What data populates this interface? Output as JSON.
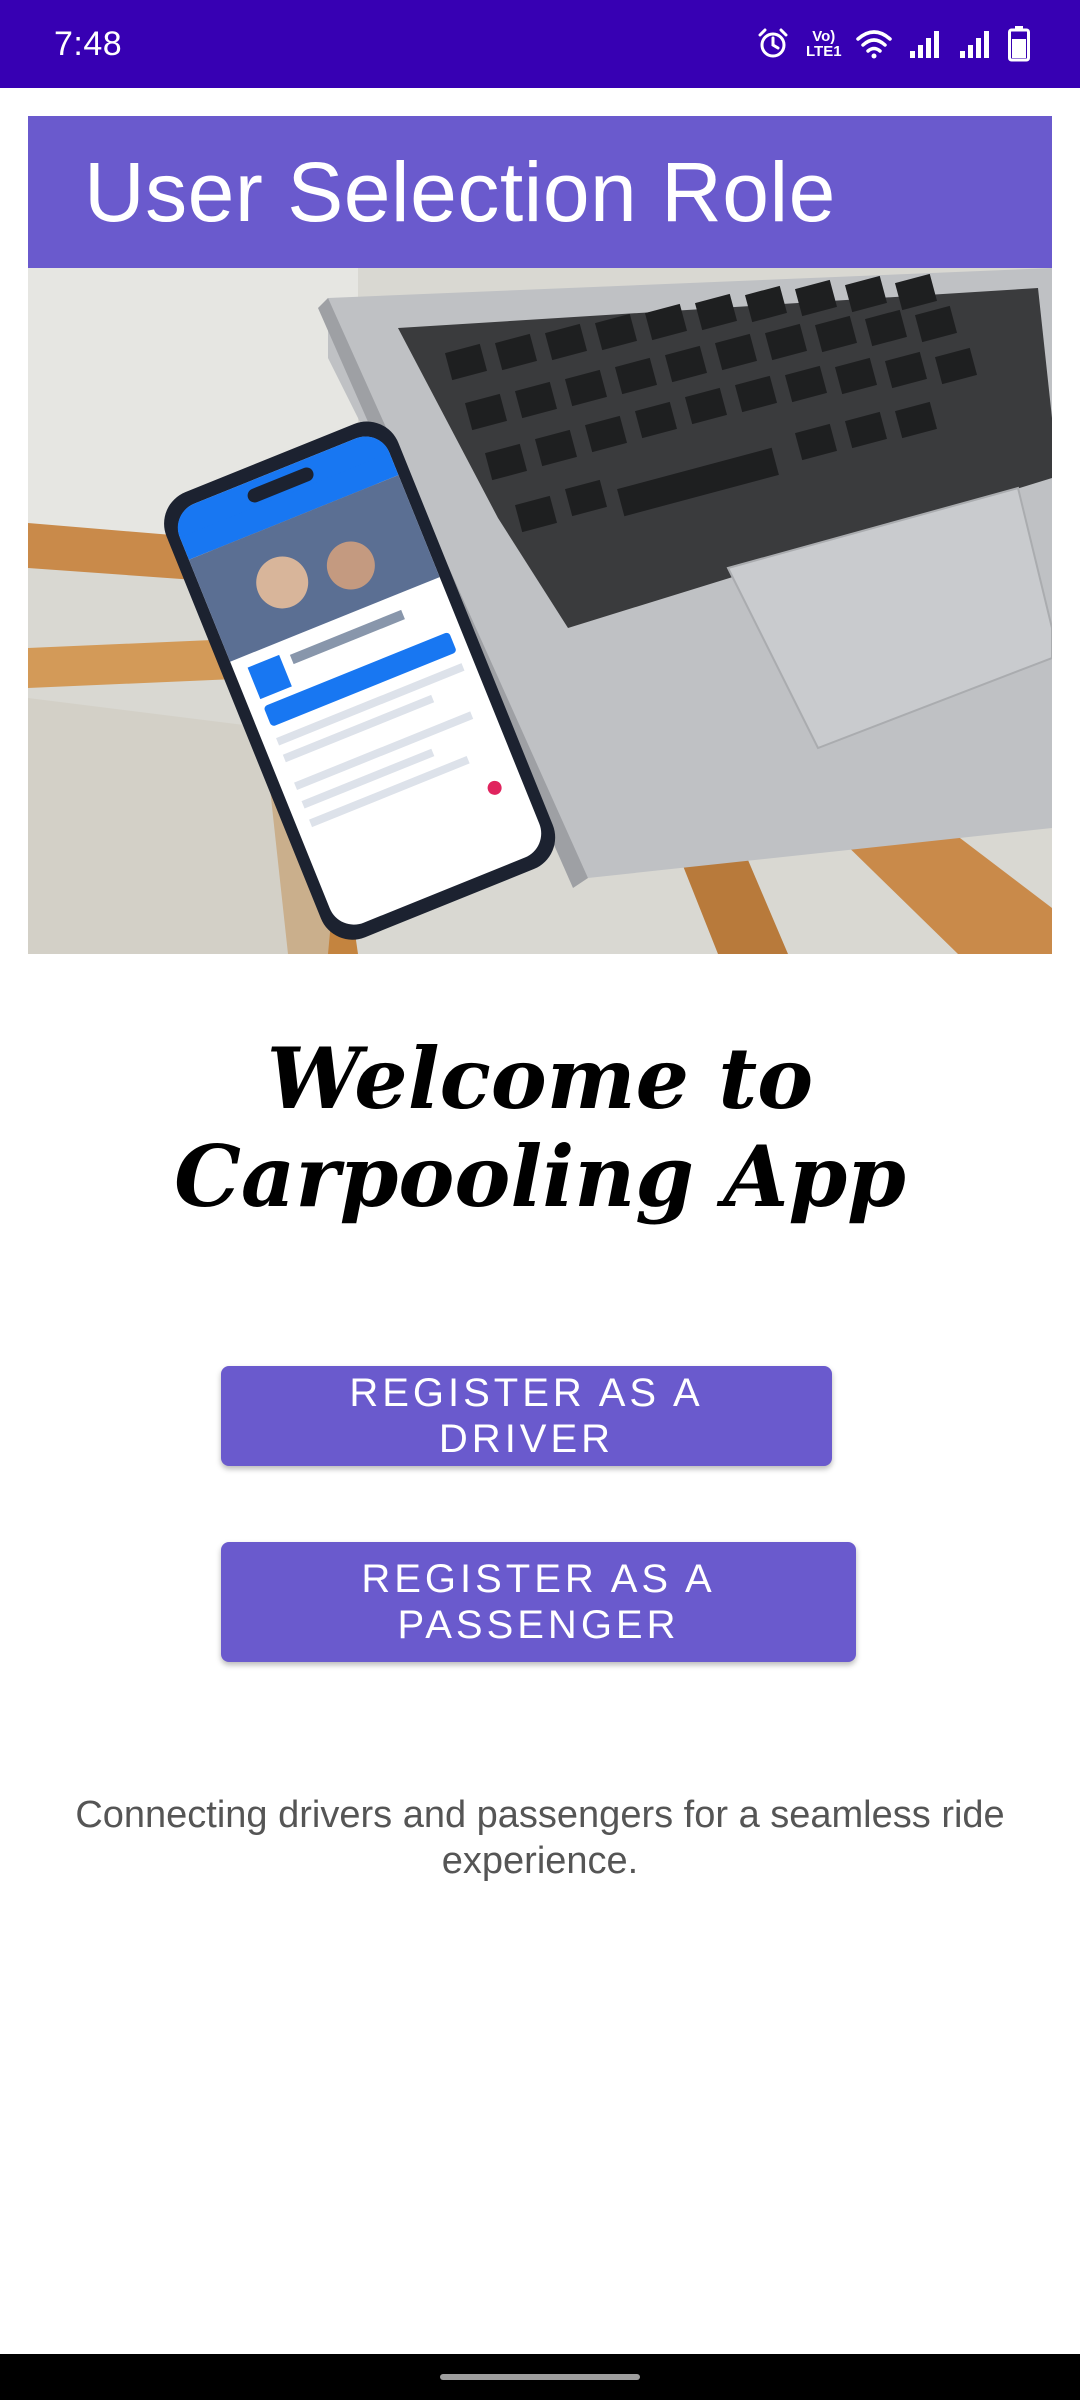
{
  "status_bar": {
    "time": "7:48",
    "volte_line1": "Vo)",
    "volte_line2": "LTE1",
    "icons": [
      "alarm-icon",
      "volte-icon",
      "wifi-icon",
      "signal-icon",
      "signal-icon",
      "battery-icon"
    ]
  },
  "app_bar": {
    "title": "User Selection Role",
    "color": "#6a5acd"
  },
  "hero_image": {
    "description_icon": "laptop-phone-photo"
  },
  "main": {
    "welcome_heading": "Welcome to Carpooling App",
    "driver_button_label": "REGISTER AS A DRIVER",
    "passenger_button_label": "REGISTER AS A PASSENGER",
    "tagline": "Connecting drivers and passengers for a seamless ride experience."
  },
  "colors": {
    "status_bar": "#3700b3",
    "accent": "#6a5acd",
    "tagline_text": "#555555"
  }
}
